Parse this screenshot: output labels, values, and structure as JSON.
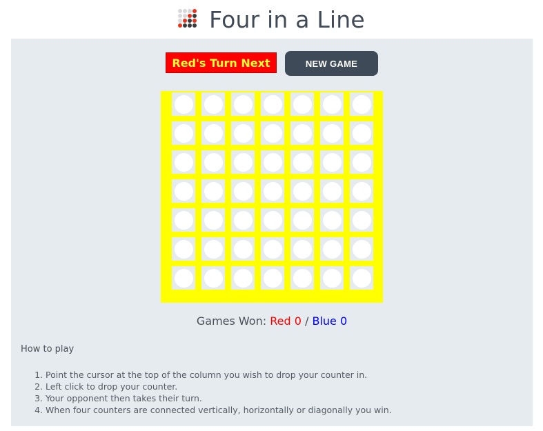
{
  "header": {
    "title": "Four in a Line",
    "logo_icon": "counters-logo-icon"
  },
  "controls": {
    "turn_label": "Red's Turn Next",
    "new_game_label": "NEW GAME"
  },
  "board": {
    "columns": 7,
    "rows": 7,
    "frame_color": "#ffff00",
    "empty_color": "#ffffff",
    "cells": [
      [
        "empty",
        "empty",
        "empty",
        "empty",
        "empty",
        "empty",
        "empty"
      ],
      [
        "empty",
        "empty",
        "empty",
        "empty",
        "empty",
        "empty",
        "empty"
      ],
      [
        "empty",
        "empty",
        "empty",
        "empty",
        "empty",
        "empty",
        "empty"
      ],
      [
        "empty",
        "empty",
        "empty",
        "empty",
        "empty",
        "empty",
        "empty"
      ],
      [
        "empty",
        "empty",
        "empty",
        "empty",
        "empty",
        "empty",
        "empty"
      ],
      [
        "empty",
        "empty",
        "empty",
        "empty",
        "empty",
        "empty",
        "empty"
      ],
      [
        "empty",
        "empty",
        "empty",
        "empty",
        "empty",
        "empty",
        "empty"
      ]
    ]
  },
  "score": {
    "label": "Games Won:",
    "red_label": "Red 0",
    "separator": "/",
    "blue_label": "Blue 0",
    "red_color": "#ff0000",
    "blue_color": "#0000ff"
  },
  "instructions": {
    "heading": "How to play",
    "steps": [
      {
        "num": "1.",
        "text": "Point the cursor at the top of the column you wish to drop your counter in."
      },
      {
        "num": "2.",
        "text": "Left click to drop your counter."
      },
      {
        "num": "3.",
        "text": "Your opponent then takes their turn."
      },
      {
        "num": "4.",
        "text": "When four counters are connected vertically, horizontally or diagonally you win."
      }
    ]
  },
  "colors": {
    "turn_background": "#ff0000",
    "turn_text": "#ffff33",
    "button_background": "#3f4a58",
    "panel_background": "#e6ebef"
  }
}
